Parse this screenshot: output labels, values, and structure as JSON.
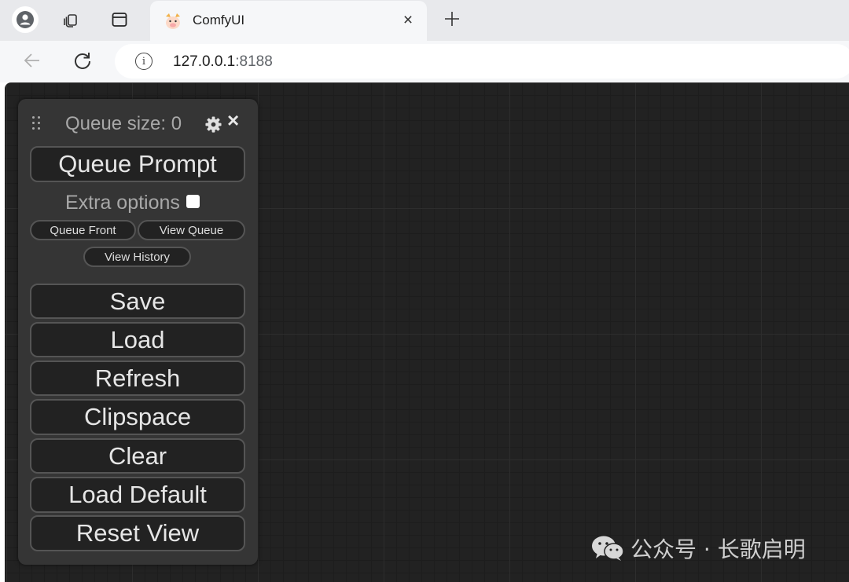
{
  "browser": {
    "tab_title": "ComfyUI",
    "tab_close": "×",
    "new_tab": "+",
    "url_host": "127.0.0.1",
    "url_port": ":8188"
  },
  "menu": {
    "queue_size": "Queue size: 0",
    "close": "×",
    "queue_prompt": "Queue Prompt",
    "extra_options": "Extra options",
    "extra_options_checked": false,
    "queue_front": "Queue Front",
    "view_queue": "View Queue",
    "view_history": "View History",
    "buttons": [
      "Save",
      "Load",
      "Refresh",
      "Clipspace",
      "Clear",
      "Load Default",
      "Reset View"
    ]
  },
  "watermark": {
    "text": "公众号 · 长歌启明"
  },
  "colors": {
    "canvas_bg": "#222222",
    "panel_bg": "#353535",
    "button_bg": "#222222",
    "button_text": "#e6e6e6",
    "muted_text": "#a8a8a8"
  },
  "icons": [
    "profile-icon",
    "tab-actions-icon",
    "sidebar-icon",
    "comfyui-favicon",
    "close-icon",
    "plus-icon",
    "back-arrow-icon",
    "reload-icon",
    "info-icon",
    "drag-handle-icon",
    "gear-icon",
    "wechat-icon"
  ]
}
